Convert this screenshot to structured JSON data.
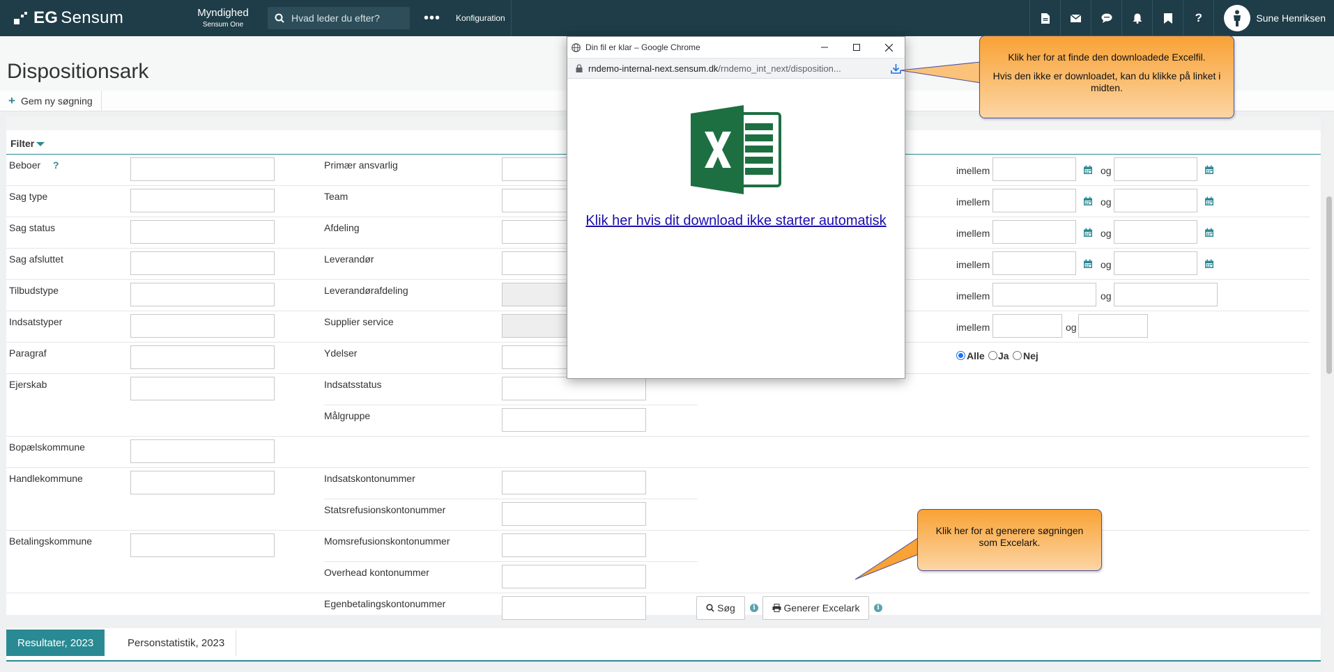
{
  "app": {
    "logo_prefix": "EG",
    "logo_name": "Sensum",
    "module_name": "Myndighed",
    "module_sub": "Sensum One",
    "search_placeholder": "Hvad leder du efter?",
    "more_label": "•••",
    "config_label": "Konfiguration",
    "user_name": "Sune Henriksen"
  },
  "page": {
    "title": "Dispositionsark",
    "save_search_label": "Gem ny søgning"
  },
  "filter": {
    "title": "Filter",
    "col1": [
      "Beboer",
      "Sag type",
      "Sag status",
      "Sag afsluttet",
      "Tilbudstype",
      "Indsatstyper",
      "Paragraf",
      "Ejerskab",
      "Bopælskommune",
      "Handlekommune",
      "Betalingskommune"
    ],
    "beboer_help": "?",
    "col2": [
      "Primær ansvarlig",
      "Team",
      "Afdeling",
      "Leverandør",
      "Leverandørafdeling",
      "Supplier service",
      "Ydelser",
      "Indsatsstatus",
      "Målgruppe",
      "Indsatskontonummer",
      "Statsrefusionskontonummer",
      "Momsrefusionskontonummer",
      "Overhead kontonummer",
      "Egenbetalingskontonummer"
    ],
    "range_between": "imellem",
    "range_and": "og",
    "radio_options": [
      "Alle",
      "Ja",
      "Nej"
    ],
    "radio_selected": "Alle",
    "search_button": "Søg",
    "excel_button": "Generer Excelark"
  },
  "tabs": {
    "results": "Resultater, 2023",
    "personstat": "Personstatistik, 2023"
  },
  "popup": {
    "window_title": "Din fil er klar – Google Chrome",
    "url_host": "rndemo-internal-next.sensum.dk",
    "url_path": "/rndemo_int_next/disposition...",
    "link_text": "Klik her hvis dit download ikke starter automatisk"
  },
  "callouts": {
    "download_line1": "Klik her for at finde den downloadede Excelfil.",
    "download_line2": "Hvis den ikke er downloadet, kan du klikke på linket i midten.",
    "generate_text": "Klik her for at generere søgningen som Excelark."
  },
  "colors": {
    "topbar": "#1e3d48",
    "accent": "#2a8a93",
    "callout": "#f9a235",
    "excel_green": "#1d6f42"
  }
}
